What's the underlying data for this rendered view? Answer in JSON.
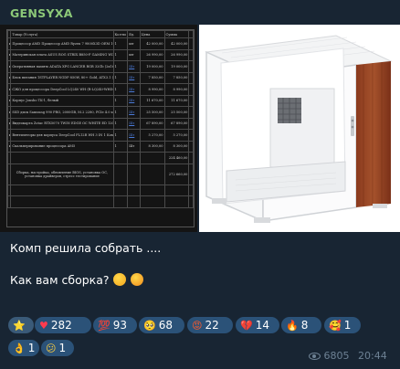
{
  "post": {
    "sender": "GENSYXA",
    "text_line1": "Комп решила собрать ....",
    "text_line2": "Как вам сборка?",
    "text_emojis": [
      "thinking-face-emoji",
      "starry-eyes-emoji"
    ],
    "views": "6805",
    "time": "20:44"
  },
  "spreadsheet": {
    "headers": [
      "Товар (Услуга)",
      "Кол-во",
      "Ед.",
      "Цена",
      "Сумма"
    ],
    "rows": [
      {
        "name": "Процессор AMD Процессор AMD Ryzen 7 9800X3D OEM 100-000001084",
        "qty": "1",
        "unit": "шт",
        "price": "42 000,00",
        "sum": "42 000,00",
        "link": false
      },
      {
        "name": "Материнская плата ASUS ROG STRIX B850-F GAMING WIFI (AM5, ATX)",
        "qty": "1",
        "unit": "шт",
        "price": "26 990,00",
        "sum": "26 990,00",
        "link": false
      },
      {
        "name": "Оперативная память ADATA XPG LANCER RGB 32Gb (2x16Gb) DDR5 6000 DIMM (AX5U6000C3016G-DTLABRWH)",
        "qty": "1",
        "unit": "Шт",
        "price": "19 000,00",
        "sum": "19 000,00",
        "link": true
      },
      {
        "name": "Блок питания 1STPLAYER NGDP 850W, 80+ Gold, ATX3.1 (HA-850BA4-WH) белый",
        "qty": "1",
        "unit": "Шт",
        "price": "7 850,00",
        "sum": "7 850,00",
        "link": true
      },
      {
        "name": "СЖО для процессора DeepCool LQ240 WH (R-LQ240-WHDSMC-G-1)",
        "qty": "1",
        "unit": "Шт",
        "price": "8 990,00",
        "sum": "8 990,00",
        "link": true
      },
      {
        "name": "Корпус Jonsbo TK-1, белый",
        "qty": "1",
        "unit": "Шт",
        "price": "11 670,00",
        "sum": "11 670,00",
        "link": true
      },
      {
        "name": "SSD диск Samsung 990 PRO, 2000GB, M.2 2280, PCIe 4.0 x4 (MZ-V9P2T0BW)",
        "qty": "1",
        "unit": "Шт",
        "price": "25 500,00",
        "sum": "25 500,00",
        "link": true
      },
      {
        "name": "Видеокарта Zotac RTX5070 TWIN EDGE OC WHITE ED 12GB GDDR7 192bit 3xDP HDMI",
        "qty": "1",
        "unit": "Шт",
        "price": "67 890,00",
        "sum": "67 890,00",
        "link": true
      },
      {
        "name": "Вентиляторы для корпуса DeepCool FL12R WH 3 IN 1 Комплект (R-FL12R-WHAPN3-G)",
        "qty": "1",
        "unit": "Шт",
        "price": "5 270,00",
        "sum": "5 270,00",
        "link": true
      },
      {
        "name": "Скальперирование процессора AM5",
        "qty": "1",
        "unit": "Шт",
        "price": "8 300,00",
        "sum": "8 300,00",
        "link": false
      }
    ],
    "subtotal": "224 460,00",
    "service_note": "Сборка, настройка, обновление BIOS, установка ОС, установка драйверов, стресс тестирование",
    "total": "272 660,00"
  },
  "reactions": [
    {
      "icon": "star-icon",
      "glyph": "⭐",
      "count": ""
    },
    {
      "icon": "heart-icon",
      "glyph": "♥",
      "count": "282"
    },
    {
      "icon": "hundred-points-icon",
      "glyph": "💯",
      "count": "93"
    },
    {
      "icon": "pleading-face-icon",
      "glyph": "🥺",
      "count": "68"
    },
    {
      "icon": "angry-face-icon",
      "glyph": "😡",
      "count": "22"
    },
    {
      "icon": "broken-heart-icon",
      "glyph": "💔",
      "count": "14"
    },
    {
      "icon": "fire-icon",
      "glyph": "🔥",
      "count": "8"
    },
    {
      "icon": "smiling-hearts-icon",
      "glyph": "🥰",
      "count": "1"
    },
    {
      "icon": "ok-hand-icon",
      "glyph": "👌",
      "count": "1"
    },
    {
      "icon": "confused-face-icon",
      "glyph": "😕",
      "count": "1"
    }
  ]
}
